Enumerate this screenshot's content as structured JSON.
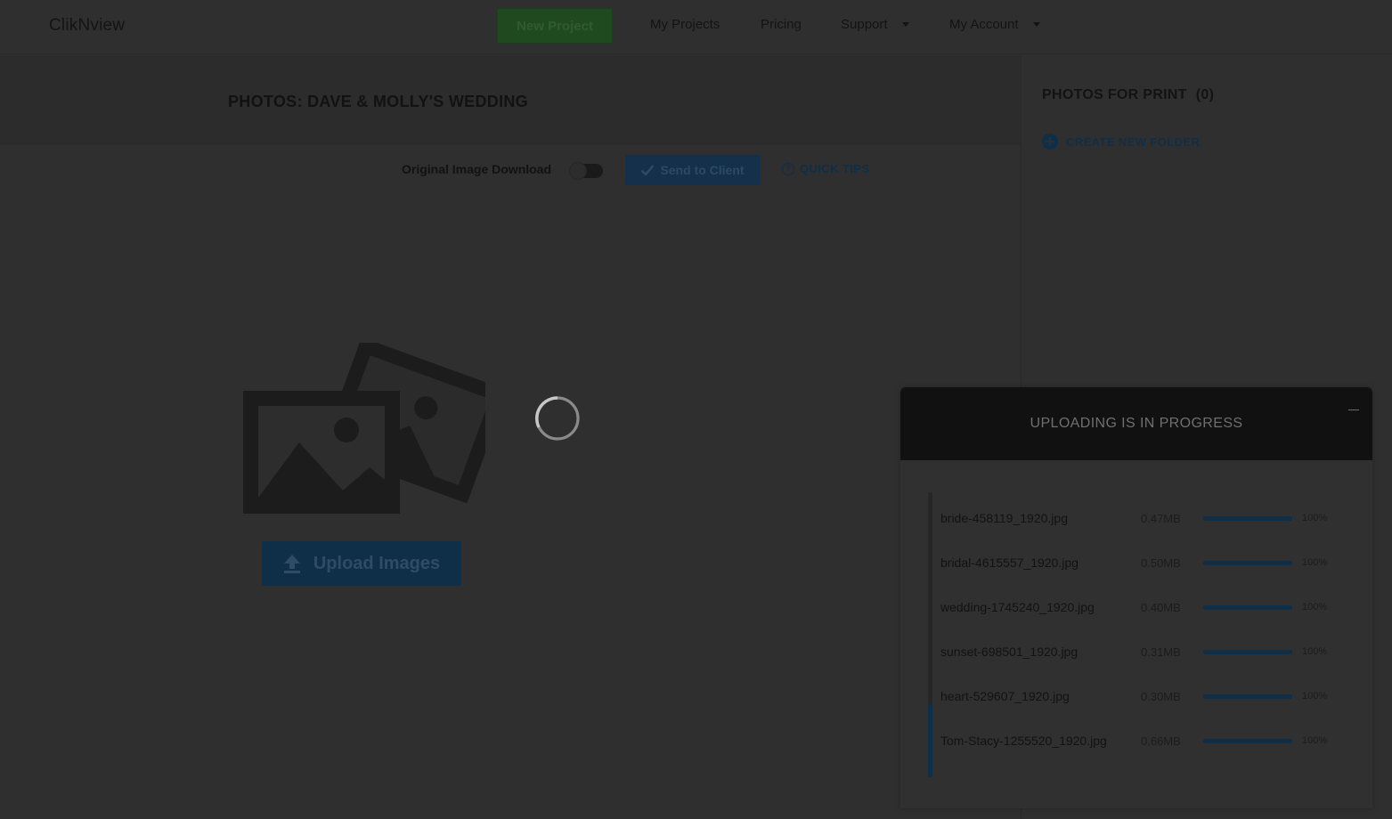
{
  "header": {
    "logo": "ClikNview",
    "new_project": "New Project",
    "nav": {
      "my_projects": "My Projects",
      "pricing": "Pricing",
      "support": "Support",
      "my_account": "My Account"
    }
  },
  "page": {
    "title": "PHOTOS: DAVE & MOLLY'S WEDDING"
  },
  "toolbar": {
    "original_download_label": "Original Image Download",
    "original_download_enabled": false,
    "send_label": "Send to Client",
    "quick_tips": "QUICK TIPS"
  },
  "empty_state": {
    "upload_label": "Upload Images"
  },
  "sidebar": {
    "title": "PHOTOS FOR PRINT",
    "count": "(0)",
    "create_folder": "CREATE NEW FOLDER"
  },
  "upload_panel": {
    "title": "UPLOADING IS IN PROGRESS",
    "files": [
      {
        "name": "bride-458119_1920.jpg",
        "size": "0.47MB",
        "progress_label": "100%",
        "progress": 1.0
      },
      {
        "name": "bridal-4615557_1920.jpg",
        "size": "0.50MB",
        "progress_label": "100%",
        "progress": 1.0
      },
      {
        "name": "wedding-1745240_1920.jpg",
        "size": "0.40MB",
        "progress_label": "100%",
        "progress": 1.0
      },
      {
        "name": "sunset-698501_1920.jpg",
        "size": "0.31MB",
        "progress_label": "100%",
        "progress": 1.0
      },
      {
        "name": "heart-529607_1920.jpg",
        "size": "0.30MB",
        "progress_label": "100%",
        "progress": 1.0
      },
      {
        "name": "Tom-Stacy-1255520_1920.jpg",
        "size": "0.66MB",
        "progress_label": "100%",
        "progress": 1.0
      }
    ]
  },
  "colors": {
    "overlay_background": "#2f2f2f",
    "accent_blue": "#0f2e48",
    "accent_green": "#1f4a1f",
    "panel_header": "#111111"
  },
  "icons": {
    "caret": "caret-down-icon",
    "check": "check-icon",
    "help": "question-circle-icon",
    "plus": "plus-circle-icon",
    "upload": "upload-arrow-icon",
    "placeholder": "photos-placeholder-icon",
    "spinner": "loading-spinner-icon",
    "minimize": "minimize-icon"
  }
}
